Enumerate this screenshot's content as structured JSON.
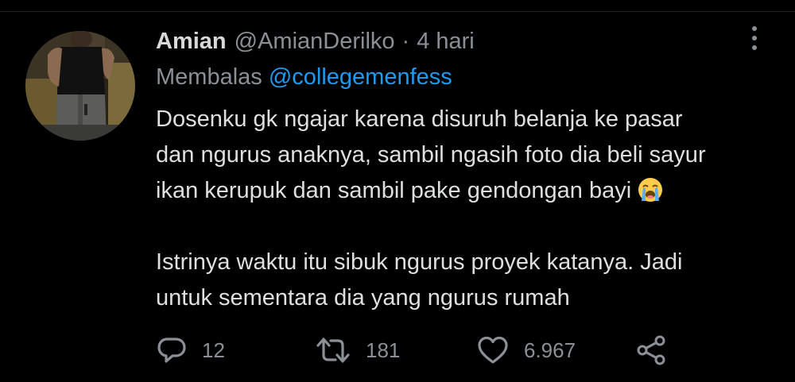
{
  "tweet": {
    "author": {
      "display_name": "Amian",
      "handle": "@AmianDerilko"
    },
    "separator": "·",
    "time": "4 hari",
    "reply_prefix": "Membalas",
    "reply_to": "@collegemenfess",
    "text_lines": [
      "Dosenku gk ngajar karena disuruh belanja ke pasar",
      "dan ngurus anaknya, sambil ngasih foto dia beli sayur",
      "ikan kerupuk dan sambil pake gendongan bayi",
      "",
      "Istrinya waktu itu sibuk ngurus proyek katanya. Jadi",
      "untuk sementara dia yang ngurus rumah"
    ],
    "emoji": "loudly-crying-face",
    "actions": {
      "reply_count": "12",
      "retweet_count": "181",
      "like_count": "6.967"
    }
  },
  "icons": {
    "more": "more-vertical-icon",
    "reply": "reply-bubble-icon",
    "retweet": "retweet-icon",
    "like": "heart-icon",
    "share": "share-icon"
  },
  "colors": {
    "background": "#000000",
    "primary_text": "#dddfe1",
    "secondary_text": "#8b9096",
    "mention": "#1d9bf0"
  }
}
